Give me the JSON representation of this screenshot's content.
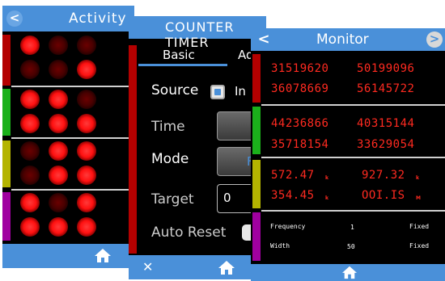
{
  "activity": {
    "title": "Activity",
    "back": "<",
    "strip_colors": [
      "#b40000",
      "#1bb01b",
      "#b4b400",
      "#a000a0"
    ],
    "leds": [
      [
        1,
        0,
        0,
        0,
        0,
        1
      ],
      [
        1,
        1,
        0,
        1,
        1,
        1
      ],
      [
        0,
        1,
        1,
        0,
        1,
        1
      ],
      [
        1,
        0,
        1,
        1,
        1,
        1
      ]
    ]
  },
  "counter": {
    "title": "COUNTER TIMER",
    "tab_basic": "Basic",
    "tab_advanced": "Ad",
    "source_label": "Source",
    "source_option": "In",
    "time_label": "Time",
    "mode_label": "Mode",
    "mode_value_partial": "F",
    "target_label": "Target",
    "target_value": "0",
    "auto_reset_label": "Auto Reset",
    "close_icon": "✕"
  },
  "monitor": {
    "title": "Monitor",
    "back": "<",
    "forward": ">",
    "strip_colors": [
      "#b40000",
      "#1bb01b",
      "#b4b400",
      "#a000a0"
    ],
    "row1": {
      "a": "31519620",
      "b": "50199096",
      "c": "36078669",
      "d": "56145722"
    },
    "row2": {
      "a": "44236866",
      "b": "40315144",
      "c": "35718154",
      "d": "33629054"
    },
    "row3": {
      "a": "572.47",
      "a_unit": "k",
      "b": "927.32",
      "b_unit": "k",
      "c": "354.45",
      "c_unit": "k",
      "d": "OOI.IS",
      "d_unit": "M"
    },
    "row4": {
      "freq_label": "Frequency",
      "freq_value": "1",
      "freq_mode": "Fixed",
      "width_label": "Width",
      "width_value": "50",
      "width_mode": "Fixed"
    }
  }
}
